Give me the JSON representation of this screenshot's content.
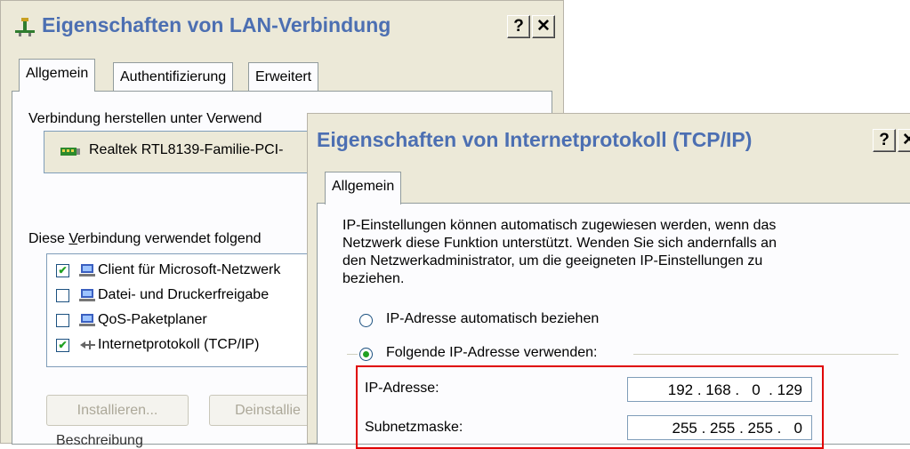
{
  "lan_window": {
    "title": "Eigenschaften von LAN-Verbindung",
    "help_btn": "?",
    "close_btn": "✕",
    "tabs": [
      {
        "label": "Allgemein",
        "active": true
      },
      {
        "label": "Authentifizierung",
        "active": false
      },
      {
        "label": "Erweitert",
        "active": false
      }
    ],
    "connect_using_label": "Verbindung herstellen unter Verwend",
    "adapter_name": "Realtek RTL8139-Familie-PCI-",
    "components_label_pre": "Diese ",
    "components_label_u": "V",
    "components_label_post": "erbindung verwendet folgend",
    "components": [
      {
        "label": "Client für Microsoft-Netzwerk",
        "checked": true,
        "icon": "network-client-icon"
      },
      {
        "label": "Datei- und Druckerfreigabe",
        "checked": false,
        "icon": "network-service-icon"
      },
      {
        "label": "QoS-Paketplaner",
        "checked": false,
        "icon": "network-service-icon"
      },
      {
        "label": "Internetprotokoll (TCP/IP)",
        "checked": true,
        "icon": "protocol-icon"
      }
    ],
    "install_btn": "Installieren...",
    "uninstall_btn": "Deinstallie",
    "description_label": "Beschreibung"
  },
  "tcpip_window": {
    "title": "Eigenschaften von Internetprotokoll (TCP/IP)",
    "help_btn": "?",
    "close_btn": "✕",
    "tab": "Allgemein",
    "info_lines": [
      "IP-Einstellungen können automatisch zugewiesen werden, wenn das",
      "Netzwerk diese Funktion unterstützt. Wenden Sie sich andernfalls an",
      "den Netzwerkadministrator, um die geeigneten IP-Einstellungen zu",
      "beziehen."
    ],
    "radio_auto": "IP-Adresse automatisch beziehen",
    "radio_manual": "Folgende IP-Adresse verwenden:",
    "ip_label": "IP-Adresse:",
    "ip_value": "192 . 168 .   0  . 129",
    "subnet_label": "Subnetzmaske:",
    "subnet_value": "255 . 255 . 255 .   0"
  },
  "colors": {
    "title_text": "#4c6fb2",
    "highlight_box": "#e00000",
    "check_mark": "#21a121"
  }
}
